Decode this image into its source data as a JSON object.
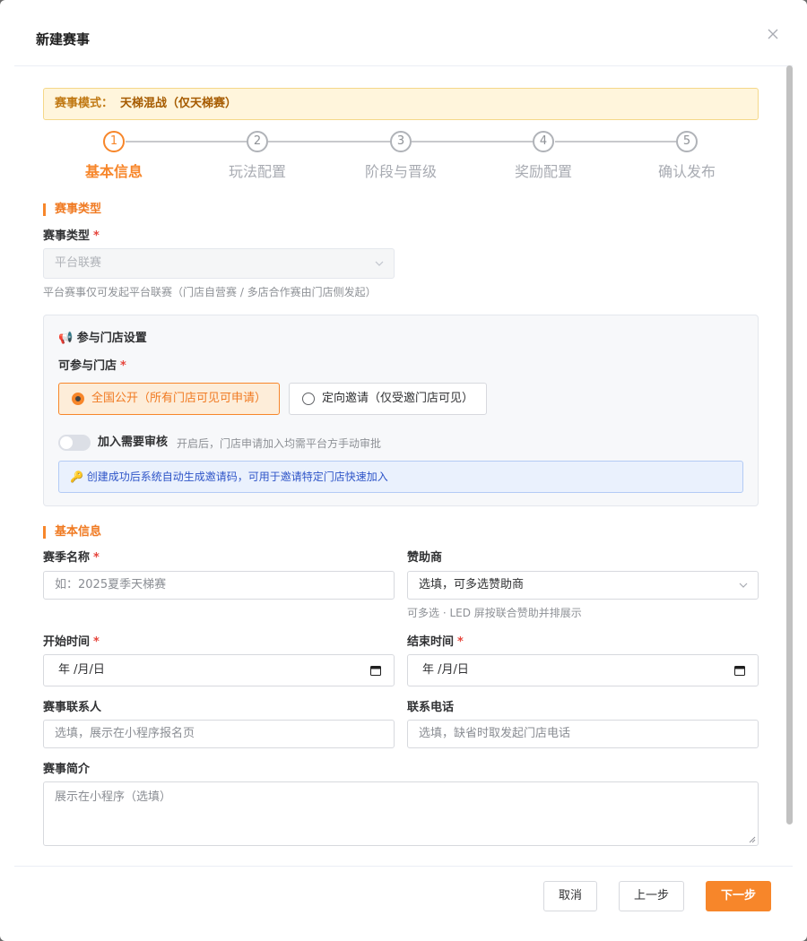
{
  "modal": {
    "title": "新建赛事"
  },
  "banner": {
    "label": "赛事模式：",
    "value": "天梯混战（仅天梯赛）"
  },
  "steps": [
    {
      "num": "1",
      "label": "基本信息",
      "active": true
    },
    {
      "num": "2",
      "label": "玩法配置",
      "active": false
    },
    {
      "num": "3",
      "label": "阶段与晋级",
      "active": false
    },
    {
      "num": "4",
      "label": "奖励配置",
      "active": false
    },
    {
      "num": "5",
      "label": "确认发布",
      "active": false
    }
  ],
  "section_type": {
    "title": "赛事类型",
    "field_label": "赛事类型",
    "required": "*",
    "select_value": "平台联赛",
    "hint": "平台赛事仅可发起平台联赛（门店自营赛 / 多店合作赛由门店侧发起）"
  },
  "store_panel": {
    "title": "📢 参与门店设置",
    "field_label": "可参与门店",
    "required": "*",
    "option_public": "全国公开（所有门店可见可申请）",
    "option_invite": "定向邀请（仅受邀门店可见）",
    "selected": "public",
    "toggle_label": "加入需要审核",
    "toggle_hint": "开启后，门店申请加入均需平台方手动审批",
    "toggle_on": false,
    "info": "🔑 创建成功后系统自动生成邀请码，可用于邀请特定门店快速加入"
  },
  "section_basic": {
    "title": "基本信息",
    "season_label": "赛季名称",
    "season_required": "*",
    "season_placeholder": "如：2025夏季天梯赛",
    "sponsor_label": "赞助商",
    "sponsor_placeholder": "选填，可多选赞助商",
    "sponsor_hint": "可多选 · LED 屏按联合赞助并排展示",
    "start_label": "开始时间",
    "start_required": "*",
    "start_value": "年 /月/日",
    "end_label": "结束时间",
    "end_required": "*",
    "end_value": "年 /月/日",
    "contact_label": "赛事联系人",
    "contact_placeholder": "选填，展示在小程序报名页",
    "phone_label": "联系电话",
    "phone_placeholder": "选填，缺省时取发起门店电话",
    "intro_label": "赛事简介",
    "intro_placeholder": "展示在小程序（选填）"
  },
  "footer": {
    "cancel": "取消",
    "prev": "上一步",
    "next": "下一步"
  },
  "colors": {
    "accent": "#f7862a",
    "banner_bg": "#fff5dc",
    "info_bg": "#eaf1fd",
    "required": "#e6453c"
  },
  "icons": {
    "close": "close-icon",
    "chevron": "chevron-down-icon",
    "calendar": "calendar-icon"
  }
}
